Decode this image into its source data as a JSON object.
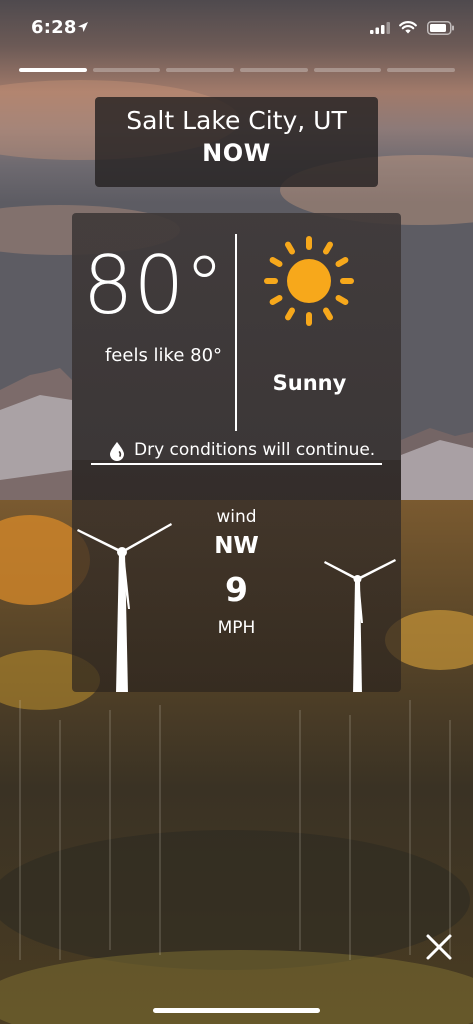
{
  "status_bar": {
    "time": "6:28",
    "signal_icon": "cellular-signal-icon",
    "wifi_icon": "wifi-icon",
    "battery_icon": "battery-icon",
    "location_icon": "location-arrow-icon"
  },
  "story_progress": {
    "segments": 6,
    "active_segment": 1,
    "active_fill": 1.0
  },
  "header": {
    "city": "Salt Lake City, UT",
    "period": "NOW"
  },
  "current": {
    "temperature": "80°",
    "feels_like": "feels like 80°",
    "condition": "Sunny",
    "condition_icon": "sun-icon",
    "summary_icon": "water-drop-icon",
    "summary": "Dry conditions will continue."
  },
  "wind": {
    "label": "wind",
    "direction": "NW",
    "speed": "9",
    "unit": "MPH",
    "icon": "wind-turbine-icon"
  },
  "controls": {
    "close_icon": "close-icon"
  },
  "colors": {
    "sun": "#F7A81B",
    "card_bg": "#2B2626",
    "text": "#FFFFFF"
  }
}
